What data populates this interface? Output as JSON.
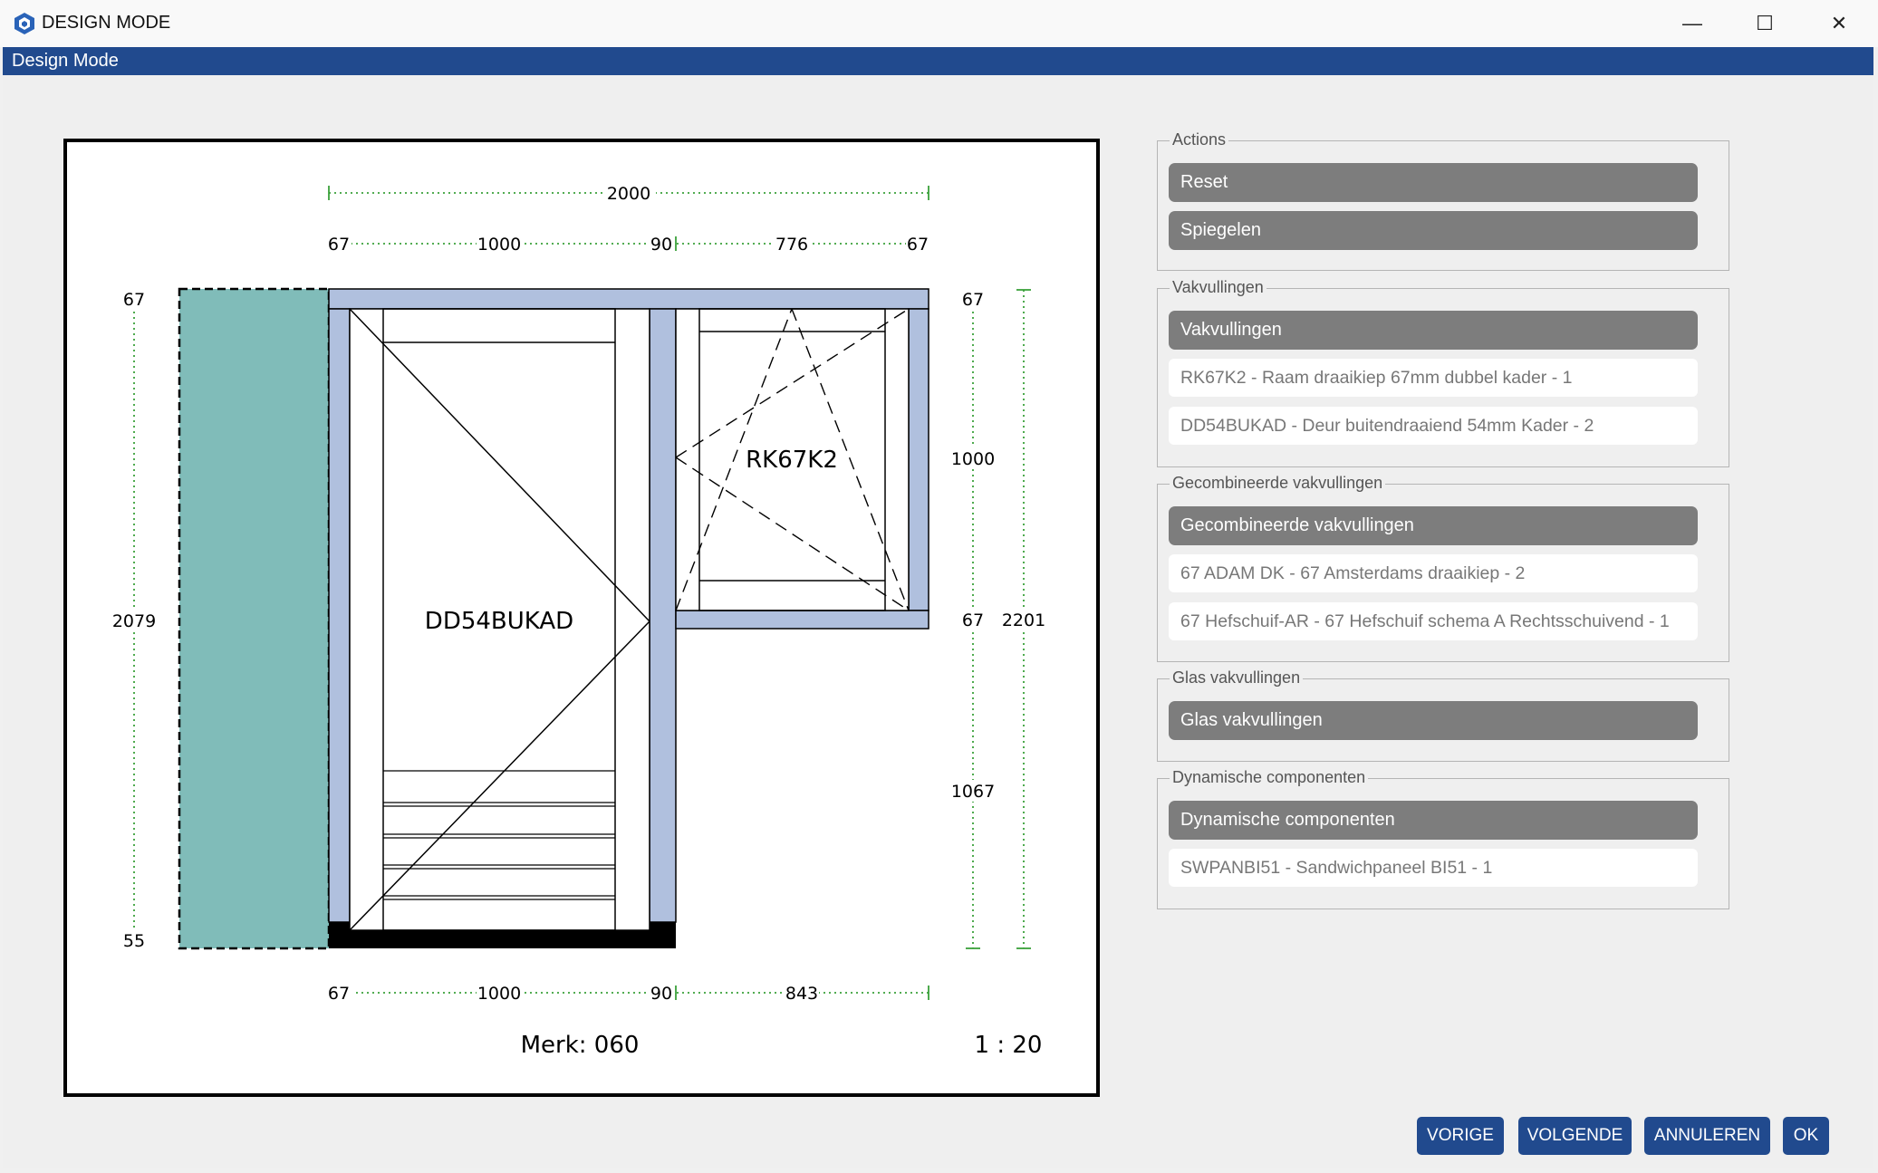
{
  "window": {
    "title": "DESIGN MODE",
    "minimize": "—",
    "maximize": "☐",
    "close": "✕"
  },
  "menubar": {
    "title": "Design Mode"
  },
  "drawing": {
    "dims": {
      "top_total": "2000",
      "top_67a": "67",
      "top_1000": "1000",
      "top_90": "90",
      "top_776": "776",
      "top_67b": "67",
      "left_67": "67",
      "left_2079": "2079",
      "left_55": "55",
      "right_67a": "67",
      "right_1000": "1000",
      "right_67b": "67",
      "right_1067": "1067",
      "right_2201": "2201",
      "bot_67": "67",
      "bot_1000": "1000",
      "bot_90": "90",
      "bot_843": "843"
    },
    "door_label": "DD54BUKAD",
    "window_label": "RK67K2",
    "merk": "Merk: 060",
    "scale": "1 : 20"
  },
  "sections": {
    "actions": {
      "legend": "Actions",
      "buttons": [
        "Reset",
        "Spiegelen"
      ]
    },
    "vakvullingen": {
      "legend": "Vakvullingen",
      "button": "Vakvullingen",
      "items": [
        "RK67K2 - Raam draaikiep 67mm dubbel kader - 1",
        "DD54BUKAD - Deur buitendraaiend 54mm Kader - 2"
      ]
    },
    "gecombineerde": {
      "legend": "Gecombineerde vakvullingen",
      "button": "Gecombineerde vakvullingen",
      "items": [
        "67 ADAM DK - 67 Amsterdams draaikiep - 2",
        "67 Hefschuif-AR - 67 Hefschuif schema A Rechtsschuivend - 1"
      ]
    },
    "glas": {
      "legend": "Glas vakvullingen",
      "button": "Glas vakvullingen"
    },
    "dynamische": {
      "legend": "Dynamische componenten",
      "button": "Dynamische componenten",
      "items": [
        "SWPANBI51 - Sandwichpaneel BI51 - 1"
      ]
    }
  },
  "footer": {
    "prev": "VORIGE",
    "next": "VOLGENDE",
    "cancel": "ANNULEREN",
    "ok": "OK"
  },
  "colors": {
    "accent": "#214a8e",
    "frame": "#b0c0de",
    "panel_fill": "#80bcb9",
    "dim_green": "#2aa02a"
  }
}
